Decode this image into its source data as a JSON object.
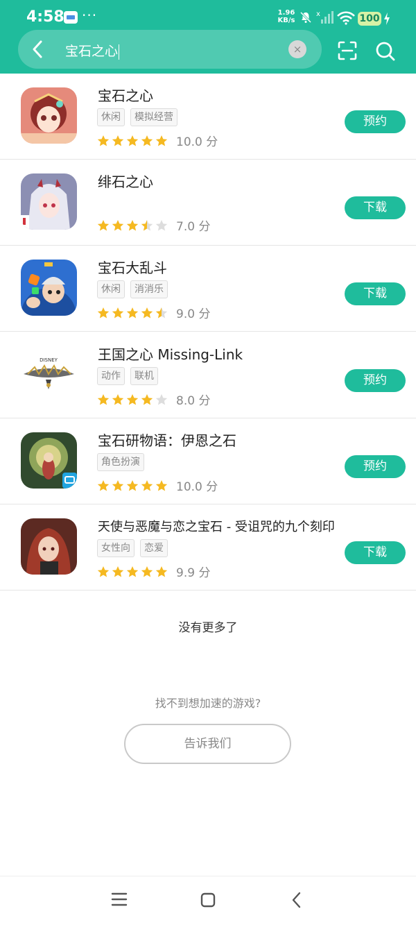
{
  "status_bar": {
    "time": "4:58",
    "more": "···",
    "net_speed_value": "1.96",
    "net_speed_unit": "KB/s",
    "battery": "100"
  },
  "search": {
    "query": "宝石之心",
    "clear_label": "×"
  },
  "results": [
    {
      "title": "宝石之心",
      "tags": [
        "休闲",
        "模拟经营"
      ],
      "rating": 5,
      "score": "10.0 分",
      "action": "预约"
    },
    {
      "title": "绯石之心",
      "tags": [],
      "rating": 3.5,
      "score": "7.0 分",
      "action": "下载"
    },
    {
      "title": "宝石大乱斗",
      "tags": [
        "休闲",
        "消消乐"
      ],
      "rating": 4.5,
      "score": "9.0 分",
      "action": "下载"
    },
    {
      "title": "王国之心 Missing-Link",
      "tags": [
        "动作",
        "联机"
      ],
      "rating": 4,
      "score": "8.0 分",
      "action": "预约"
    },
    {
      "title": "宝石研物语：伊恩之石",
      "tags": [
        "角色扮演"
      ],
      "rating": 5,
      "score": "10.0 分",
      "action": "预约"
    },
    {
      "title": "天使与恶魔与恋之宝石 - 受诅咒的九个刻印",
      "tags": [
        "女性向",
        "恋爱"
      ],
      "rating": 5,
      "score": "9.9 分",
      "action": "下载"
    }
  ],
  "footer": {
    "no_more": "没有更多了",
    "cant_find": "找不到想加速的游戏?",
    "tell_us": "告诉我们"
  },
  "colors": {
    "accent": "#1fbc9c",
    "star": "#f5b921",
    "star_empty": "#dddddd"
  },
  "icons": [
    "back-arrow-icon",
    "clear-icon",
    "scan-icon",
    "search-icon",
    "menu-icon",
    "home-icon",
    "back-icon",
    "star-icon"
  ]
}
